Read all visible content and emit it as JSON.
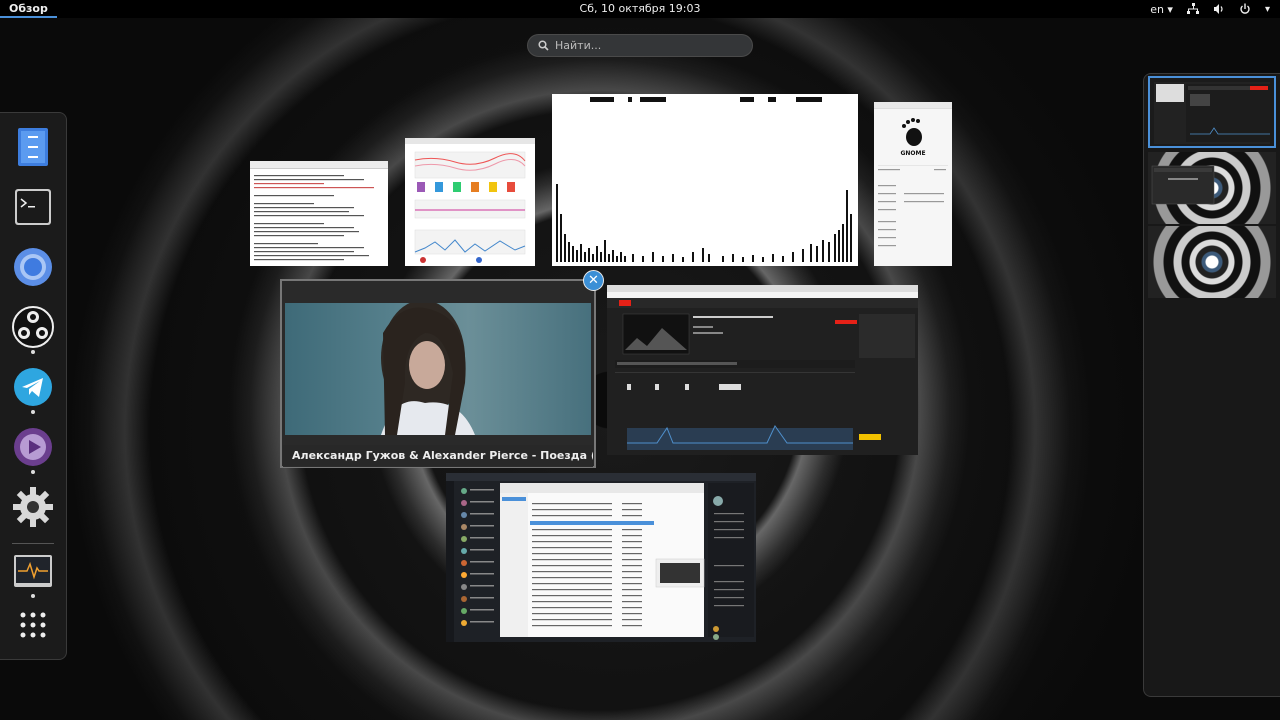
{
  "topbar": {
    "activities_label": "Обзор",
    "clock": "Сб, 10 октября  19:03",
    "language": "en"
  },
  "search": {
    "placeholder": "Найти..."
  },
  "dash": {
    "items": [
      {
        "name": "files-icon"
      },
      {
        "name": "terminal-icon"
      },
      {
        "name": "chromium-icon"
      },
      {
        "name": "obs-icon"
      },
      {
        "name": "telegram-icon"
      },
      {
        "name": "media-player-icon"
      },
      {
        "name": "settings-gear-icon"
      },
      {
        "name": "system-monitor-icon"
      },
      {
        "name": "show-apps-icon"
      }
    ]
  },
  "windows": {
    "video_caption": "Александр Гужов & Alexander Pierce - Поезда ( Remix ) - ...",
    "gnome_logo_text": "GNOME"
  },
  "colors": {
    "accent": "#4a90d9",
    "topbar_bg": "#000000",
    "close_button": "#3b8fd6"
  }
}
